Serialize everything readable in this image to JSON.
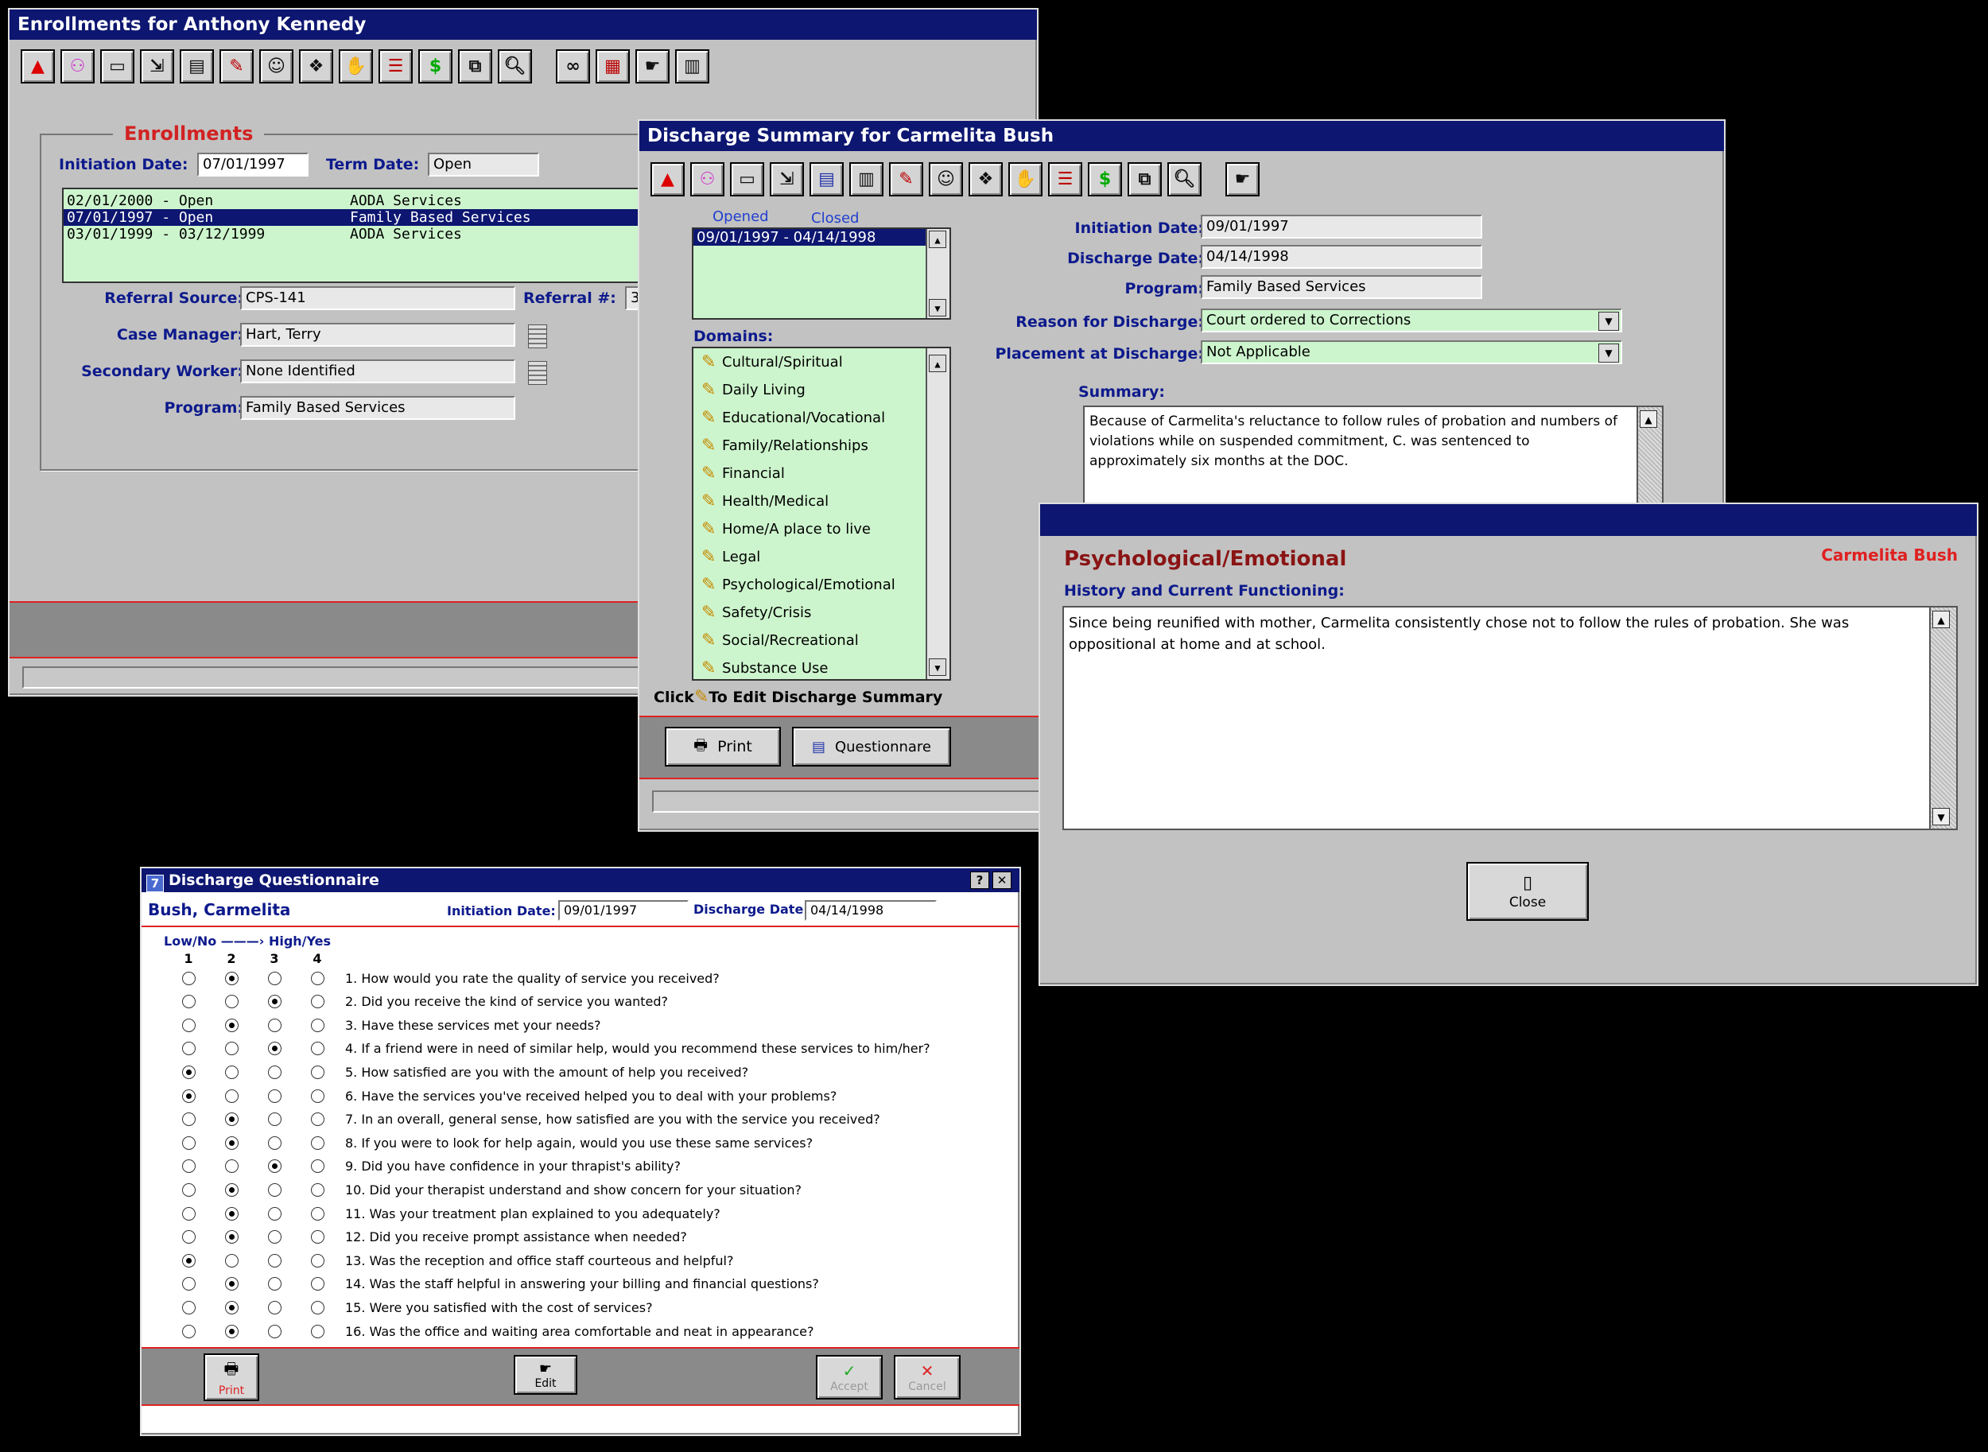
{
  "enrollments_window": {
    "title": "Enrollments for Anthony Kennedy",
    "section_title": "Enrollments",
    "initiation_label": "Initiation Date:",
    "initiation_value": "07/01/1997",
    "term_label": "Term Date:",
    "term_value": "Open",
    "list": [
      {
        "dates": "02/01/2000 - Open",
        "service": "AODA Services"
      },
      {
        "dates": "07/01/1997 - Open",
        "service": "Family Based Services"
      },
      {
        "dates": "03/01/1999 - 03/12/1999",
        "service": "AODA Services"
      }
    ],
    "referral_source_label": "Referral Source:",
    "referral_source_value": "CPS-141",
    "referral_num_label": "Referral #:",
    "referral_num_value": "3",
    "case_manager_label": "Case Manager:",
    "case_manager_value": "Hart, Terry",
    "secondary_worker_label": "Secondary Worker:",
    "secondary_worker_value": "None Identified",
    "program_label": "Program:",
    "program_value": "Family Based Services"
  },
  "discharge_window": {
    "title": "Discharge Summary for Carmelita Bush",
    "opened_label": "Opened",
    "closed_label": "Closed",
    "period": "09/01/1997 - 04/14/1998",
    "domains_label": "Domains:",
    "domains": [
      "Cultural/Spiritual",
      "Daily Living",
      "Educational/Vocational",
      "Family/Relationships",
      "Financial",
      "Health/Medical",
      "Home/A place to live",
      "Legal",
      "Psychological/Emotional",
      "Safety/Crisis",
      "Social/Recreational",
      "Substance Use"
    ],
    "click_hint_prefix": "Click",
    "click_hint_suffix": "To Edit Discharge Summary",
    "initiation_label": "Initiation Date:",
    "initiation_value": "09/01/1997",
    "discharge_label": "Discharge Date:",
    "discharge_value": "04/14/1998",
    "program_label": "Program:",
    "program_value": "Family Based Services",
    "reason_label": "Reason for Discharge:",
    "reason_value": "Court ordered to Corrections",
    "placement_label": "Placement at Discharge:",
    "placement_value": "Not Applicable",
    "summary_label": "Summary:",
    "summary_text": "Because of Carmelita's reluctance to follow rules of probation and numbers of violations while on suspended commitment, C. was sentenced to approximately six months at the DOC.",
    "print_label": "Print",
    "questionnaire_label": "Questionnare"
  },
  "domain_window": {
    "heading": "Psychological/Emotional",
    "client_name": "Carmelita Bush",
    "history_label": "History and Current Functioning:",
    "history_text": "Since being reunified with mother, Carmelita consistently chose not to follow the rules of probation.  She was oppositional at home and at school.",
    "close_label": "Close"
  },
  "questionnaire_window": {
    "title": "Discharge Questionnaire",
    "name": "Bush, Carmelita",
    "initiation_label": "Initiation Date:",
    "initiation_value": "09/01/1997",
    "discharge_label": "Discharge Date:",
    "discharge_value": "04/14/1998",
    "scale_low": "Low/No",
    "scale_high": "High/Yes",
    "scale_numbers": [
      "1",
      "2",
      "3",
      "4"
    ],
    "questions": [
      {
        "text": "1.  How would you rate the quality of service you received?",
        "answer": 2
      },
      {
        "text": "2.  Did you receive the kind of service you wanted?",
        "answer": 3
      },
      {
        "text": "3.  Have these services met your needs?",
        "answer": 2
      },
      {
        "text": "4.  If a friend were in need of similar help, would you recommend these services to him/her?",
        "answer": 3
      },
      {
        "text": "5.  How satisfied are you with the amount of help you received?",
        "answer": 1
      },
      {
        "text": "6.  Have the services you've received helped you to deal with your problems?",
        "answer": 1
      },
      {
        "text": "7.  In an overall, general sense, how satisfied are you with the service you received?",
        "answer": 2
      },
      {
        "text": "8.  If you were to look for help again, would you use these same services?",
        "answer": 2
      },
      {
        "text": "9.  Did you have confidence in your thrapist's ability?",
        "answer": 3
      },
      {
        "text": "10. Did your therapist understand and show concern for your situation?",
        "answer": 2
      },
      {
        "text": "11. Was your treatment plan explained to you adequately?",
        "answer": 2
      },
      {
        "text": "12. Did you receive prompt assistance when needed?",
        "answer": 2
      },
      {
        "text": "13. Was the reception and office staff courteous and helpful?",
        "answer": 1
      },
      {
        "text": "14. Was the staff helpful in answering your billing and financial questions?",
        "answer": 2
      },
      {
        "text": "15. Were you satisfied with the cost of services?",
        "answer": 2
      },
      {
        "text": "16. Was the office and waiting area comfortable and neat in appearance?",
        "answer": 2
      }
    ],
    "print_label": "Print",
    "edit_label": "Edit",
    "accept_label": "Accept",
    "cancel_label": "Cancel"
  },
  "colors": {
    "titlebar": "#0d1670",
    "label_blue": "#0d1a8c",
    "accent_red": "#d22222",
    "list_green": "#cdf5cd"
  }
}
